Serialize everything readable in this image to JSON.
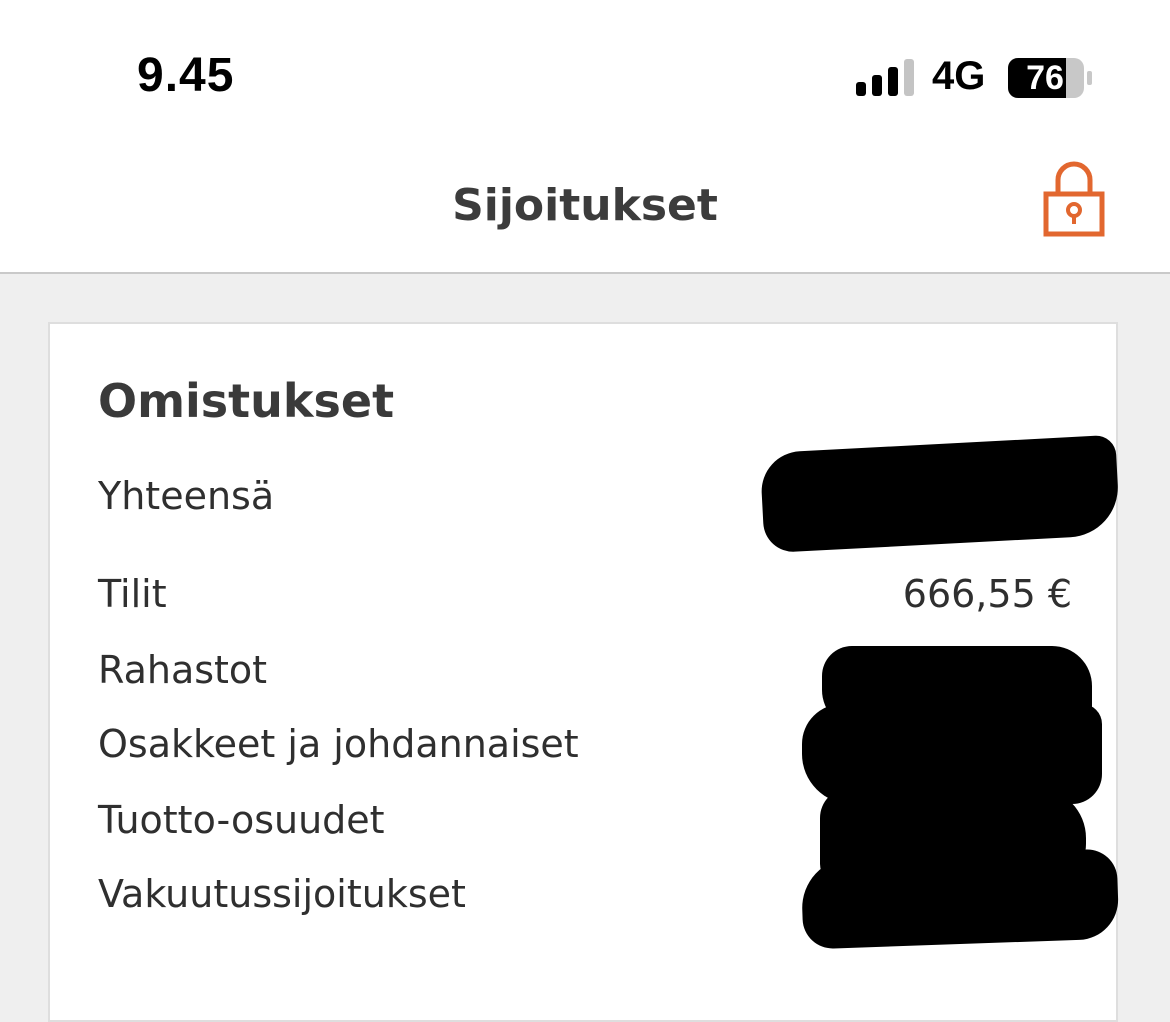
{
  "status_bar": {
    "time": "9.45",
    "network": "4G",
    "battery": "76"
  },
  "header": {
    "title": "Sijoitukset",
    "lock_icon": "lock-icon",
    "accent_color": "#e2672f"
  },
  "holdings": {
    "title": "Omistukset",
    "rows": [
      {
        "label": "Yhteensä",
        "value": ""
      },
      {
        "label": "Tilit",
        "value": "666,55 €"
      },
      {
        "label": "Rahastot",
        "value": ""
      },
      {
        "label": "Osakkeet ja johdannaiset",
        "value": ""
      },
      {
        "label": "Tuotto-osuudet",
        "value": ""
      },
      {
        "label": "Vakuutussijoitukset",
        "value": ""
      }
    ]
  }
}
